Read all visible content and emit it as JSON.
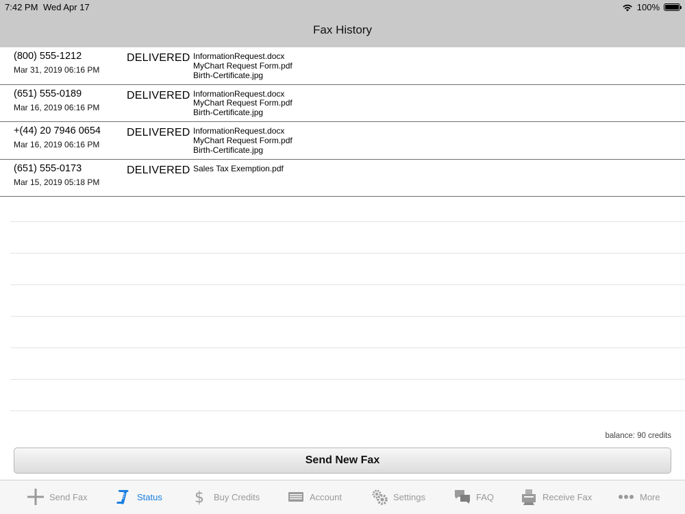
{
  "status_bar": {
    "time": "7:42 PM",
    "date": "Wed Apr 17",
    "battery": "100%"
  },
  "nav": {
    "title": "Fax History"
  },
  "faxes": [
    {
      "phone": "(800) 555-1212",
      "date": "Mar 31, 2019 06:16 PM",
      "status": "DELIVERED",
      "files": [
        "InformationRequest.docx",
        "MyChart Request Form.pdf",
        "Birth-Certificate.jpg"
      ]
    },
    {
      "phone": "(651) 555-0189",
      "date": "Mar 16, 2019 06:16 PM",
      "status": "DELIVERED",
      "files": [
        "InformationRequest.docx",
        "MyChart Request Form.pdf",
        "Birth-Certificate.jpg"
      ]
    },
    {
      "phone": "+(44) 20 7946 0654",
      "date": "Mar 16, 2019 06:16 PM",
      "status": "DELIVERED",
      "files": [
        "InformationRequest.docx",
        "MyChart Request Form.pdf",
        "Birth-Certificate.jpg"
      ]
    },
    {
      "phone": "(651) 555-0173",
      "date": "Mar 15, 2019 05:18 PM",
      "status": "DELIVERED",
      "files": [
        "Sales Tax Exemption.pdf"
      ]
    }
  ],
  "balance": "balance: 90 credits",
  "send_button": "Send New Fax",
  "tabs": [
    {
      "label": "Send Fax",
      "icon": "plus-icon"
    },
    {
      "label": "Status",
      "icon": "scroll-icon",
      "active": true
    },
    {
      "label": "Buy Credits",
      "icon": "dollar-icon"
    },
    {
      "label": "Account",
      "icon": "card-icon"
    },
    {
      "label": "Settings",
      "icon": "gears-icon"
    },
    {
      "label": "FAQ",
      "icon": "chat-bubbles-icon"
    },
    {
      "label": "Receive Fax",
      "icon": "fax-machine-icon"
    },
    {
      "label": "More",
      "icon": "ellipsis-icon"
    }
  ],
  "colors": {
    "accent": "#1a7fe0",
    "tab_inactive": "#999999",
    "header": "#c9c9c9"
  }
}
